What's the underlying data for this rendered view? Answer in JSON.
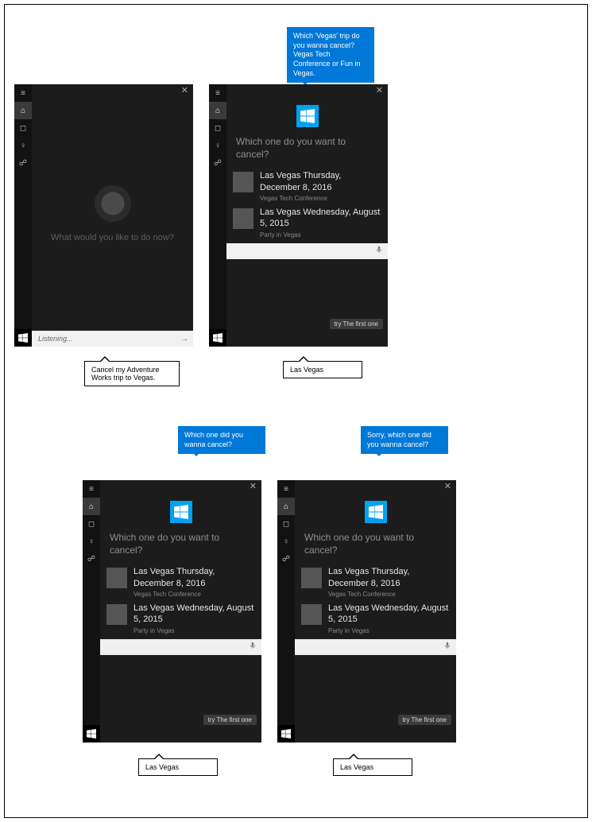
{
  "panel_idle": {
    "prompt": "What would you like to do now?",
    "search_text": "Listening..."
  },
  "panel_list": {
    "question": "Which one do you want to cancel?",
    "items": [
      {
        "title": "Las Vegas Thursday, December 8, 2016",
        "sub": "Vegas Tech Conference"
      },
      {
        "title": "Las Vegas Wednesday, August 5, 2015",
        "sub": "Party in Vegas"
      }
    ],
    "chip": "try The first one"
  },
  "bubbles": {
    "b1": "Which 'Vegas' trip do you wanna cancel? Vegas Tech Conference or Fun in Vegas.",
    "b2": "Which one did you wanna cancel?",
    "b3": "Sorry, which one did you wanna cancel?"
  },
  "callouts": {
    "c1": "Cancel my Adventure Works trip to Vegas.",
    "c2": "Las Vegas",
    "c3": "Las Vegas",
    "c4": "Las Vegas"
  }
}
